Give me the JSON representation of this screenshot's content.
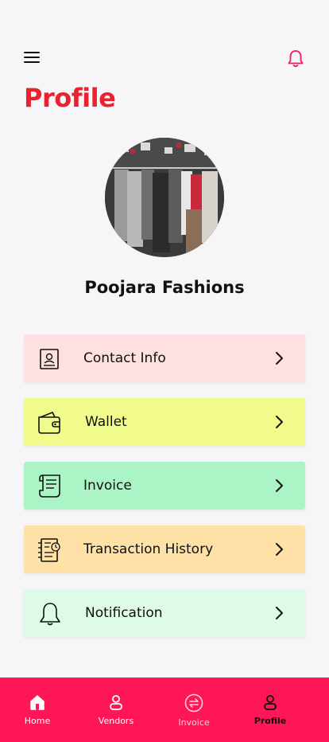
{
  "header": {
    "title": "Profile",
    "menu_icon": "hamburger-icon",
    "notification_icon": "bell-icon",
    "accent_color": "#e8232f",
    "bell_color": "#ff1656"
  },
  "profile": {
    "name": "Poojara Fashions",
    "avatar_description_icon": "clothing-rack-photo"
  },
  "menu": [
    {
      "label": "Contact Info",
      "icon": "contact-card-icon",
      "bg": "#ffe0e0"
    },
    {
      "label": "Wallet",
      "icon": "wallet-icon",
      "bg": "#f0fb8c"
    },
    {
      "label": "Invoice",
      "icon": "invoice-scroll-icon",
      "bg": "#aaf4c5"
    },
    {
      "label": "Transaction History",
      "icon": "transaction-history-icon",
      "bg": "#fde1a6"
    },
    {
      "label": "Notification",
      "icon": "bell-icon",
      "bg": "#ddfbe6"
    }
  ],
  "bottom_nav": {
    "background": "#ff1656",
    "items": [
      {
        "label": "Home",
        "icon": "home-icon"
      },
      {
        "label": "Vendors",
        "icon": "user-icon"
      },
      {
        "label": "Invoice",
        "icon": "exchange-icon"
      },
      {
        "label": "Profile",
        "icon": "profile-icon",
        "active": true
      }
    ]
  }
}
